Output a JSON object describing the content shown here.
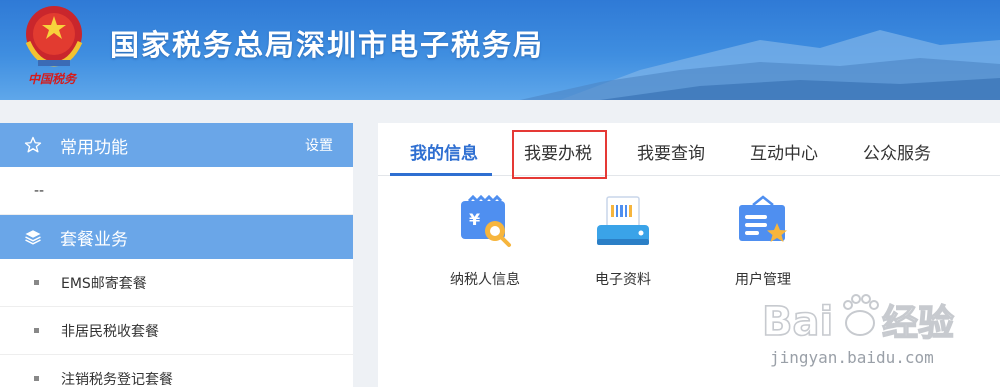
{
  "header": {
    "title": "国家税务总局深圳市电子税务局",
    "emblem_caption": "中国税务"
  },
  "sidebar": {
    "common": {
      "label": "常用功能",
      "settings_label": "设置",
      "empty_value": "--"
    },
    "package": {
      "label": "套餐业务",
      "items": [
        {
          "label": "EMS邮寄套餐"
        },
        {
          "label": "非居民税收套餐"
        },
        {
          "label": "注销税务登记套餐"
        }
      ]
    }
  },
  "tabs": [
    {
      "label": "我的信息",
      "active": true
    },
    {
      "label": "我要办税",
      "highlighted": true
    },
    {
      "label": "我要查询"
    },
    {
      "label": "互动中心"
    },
    {
      "label": "公众服务"
    }
  ],
  "services": [
    {
      "label": "纳税人信息",
      "icon": "taxpayer-info-icon"
    },
    {
      "label": "电子资料",
      "icon": "e-documents-icon"
    },
    {
      "label": "用户管理",
      "icon": "user-management-icon"
    }
  ],
  "watermark": {
    "brand": "Baidu经验",
    "url": "jingyan.baidu.com"
  },
  "colors": {
    "accent": "#2f6fd1",
    "sidebar_head": "#6aa6e8",
    "highlight": "#e53935",
    "banner": "#3f8ee0"
  }
}
